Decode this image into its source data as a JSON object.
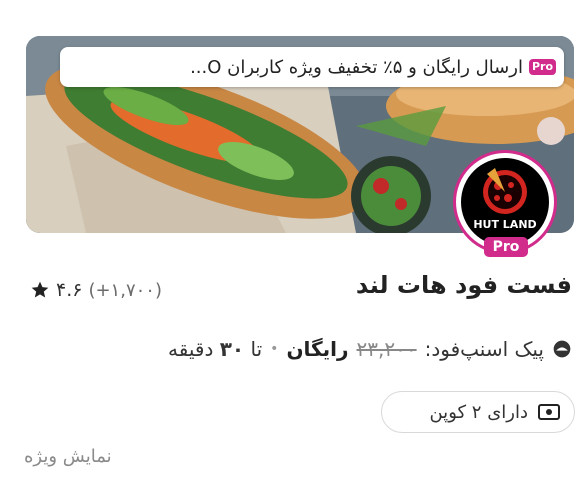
{
  "promo": {
    "badge": "Pro",
    "text": "ارسال رایگان و ۵٪ تخفیف ویژه کاربران O..."
  },
  "vendor": {
    "logo_text": "HUT LAND",
    "logo_badge": "Pro",
    "name": "فست فود هات لند",
    "rating_count": "(+۱,۷۰۰)",
    "rating_value": "۴.۶"
  },
  "delivery": {
    "label": "پیک اسنپ‌فود:",
    "old_price": "۲۳,۲۰۰",
    "price": "رایگان",
    "separator": "•",
    "time_prefix": "تا",
    "time_value": "۳۰",
    "time_unit": "دقیقه"
  },
  "coupon": {
    "text": "دارای ۲ کوپن"
  },
  "special_label": "نمایش ویژه",
  "colors": {
    "brand_pink": "#d12c8c"
  }
}
